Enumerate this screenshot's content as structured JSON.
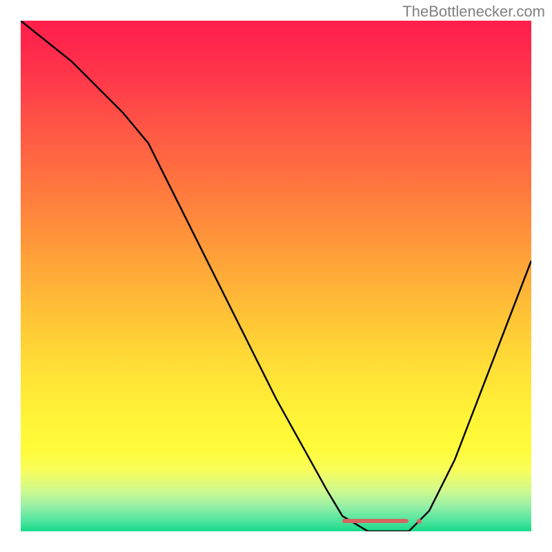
{
  "watermark": "TheBottlenecker.com",
  "chart_data": {
    "type": "line",
    "title": "",
    "xlabel": "",
    "ylabel": "",
    "xlim": [
      0,
      100
    ],
    "ylim": [
      0,
      100
    ],
    "grid": false,
    "legend": false,
    "background_gradient": {
      "top": "#ff1e4b",
      "bottom": "#17d989"
    },
    "series": [
      {
        "name": "bottleneck-curve",
        "color": "#000000",
        "x": [
          0,
          5,
          10,
          15,
          20,
          25,
          30,
          35,
          40,
          45,
          50,
          55,
          60,
          63,
          68,
          72,
          76,
          80,
          85,
          90,
          95,
          100
        ],
        "y": [
          100,
          96,
          92,
          87,
          82,
          76,
          66,
          56,
          46,
          36,
          26,
          17,
          8,
          3,
          0,
          0,
          0,
          4,
          14,
          27,
          40,
          53
        ]
      }
    ],
    "marker": {
      "name": "optimal-range",
      "color": "#d4665f",
      "x_start": 63,
      "x_end": 76,
      "y": 2,
      "dot_x": 78
    }
  }
}
